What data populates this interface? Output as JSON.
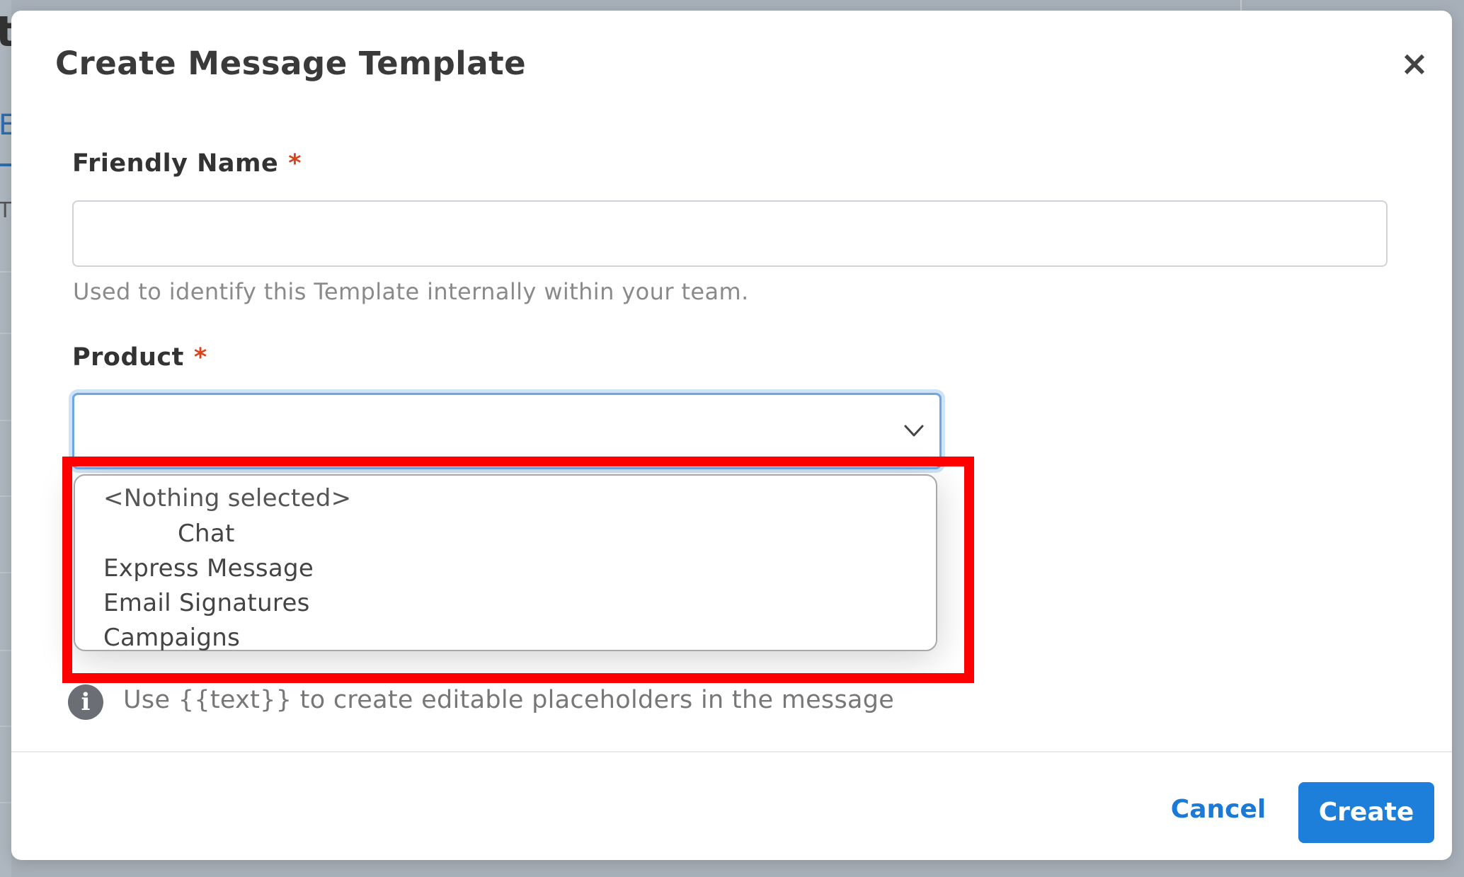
{
  "modal": {
    "title": "Create Message Template",
    "close_label": "×"
  },
  "form": {
    "friendly_name": {
      "label": "Friendly Name",
      "required_mark": "*",
      "value": "",
      "help": "Used to identify this Template internally within your team."
    },
    "product": {
      "label": "Product",
      "required_mark": "*",
      "selected": "",
      "options": [
        "<Nothing selected>",
        "Chat",
        "Express Message",
        "Email Signatures",
        "Campaigns"
      ]
    },
    "info_hint": "Use {{text}} to create editable placeholders in the message"
  },
  "footer": {
    "cancel_label": "Cancel",
    "create_label": "Create"
  },
  "background": {
    "fragment_t": "t",
    "fragment_e": "E",
    "fragment_small": "T"
  },
  "colors": {
    "accent": "#1d7fd9",
    "required": "#d9441c",
    "highlight": "#ff0000",
    "focus_ring": "#6fa6e0"
  },
  "icons": {
    "close": "close-icon",
    "chevron": "chevron-down-icon",
    "info": "info-icon"
  }
}
